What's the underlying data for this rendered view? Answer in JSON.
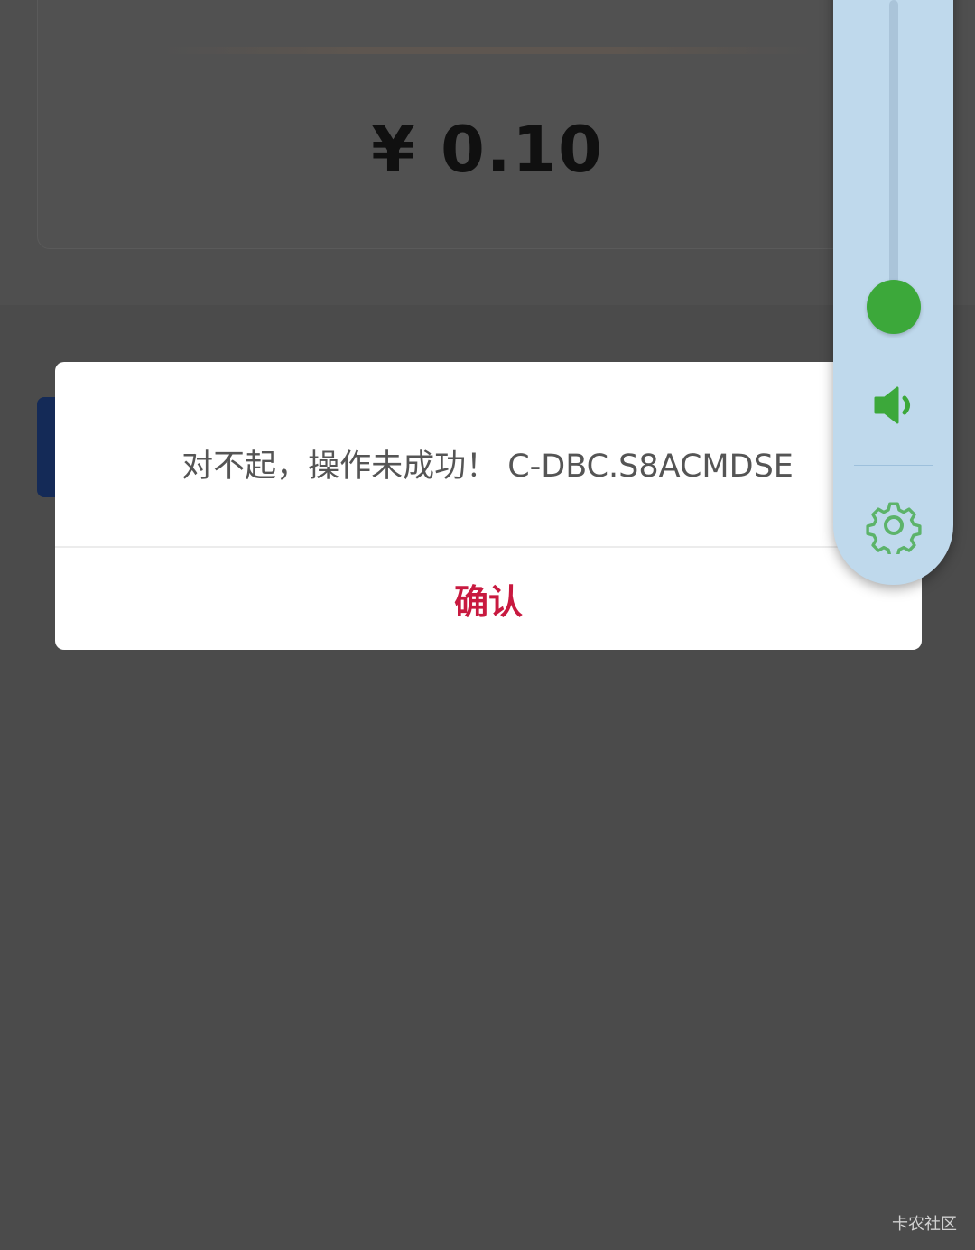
{
  "background": {
    "amount": "¥ 0.10"
  },
  "dialog": {
    "message": "对不起，操作未成功！ C-DBC.S8ACMDSE",
    "confirm_label": "确认"
  },
  "volume_panel": {
    "level_fraction": 0.0,
    "speaker_icon": "speaker-icon",
    "settings_icon": "gear-icon",
    "accent_color": "#3ca83a"
  },
  "watermark": "卡农社区",
  "colors": {
    "confirm": "#c8193f",
    "overlay": "#4b4b4b",
    "panel": "#bfd9ec"
  }
}
